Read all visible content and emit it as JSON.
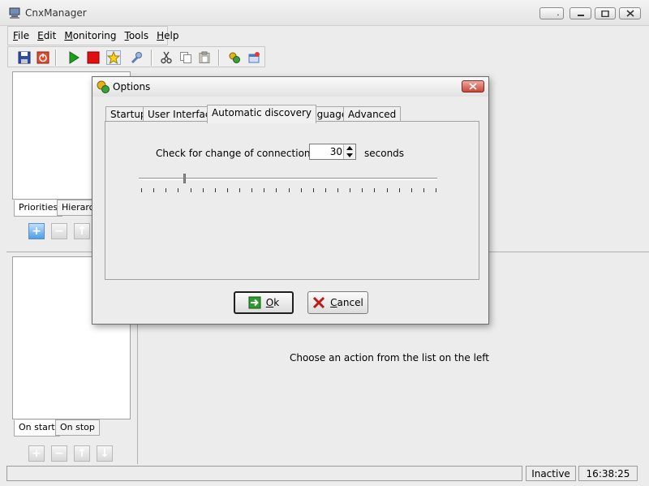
{
  "window": {
    "title": "CnxManager"
  },
  "menu": [
    {
      "label": "File",
      "key": "F",
      "rest": "ile"
    },
    {
      "label": "Edit",
      "key": "E",
      "rest": "dit"
    },
    {
      "label": "Monitoring",
      "key": "M",
      "rest": "onitoring"
    },
    {
      "label": "Tools",
      "key": "T",
      "rest": "ools"
    },
    {
      "label": "Help",
      "key": "H",
      "rest": "elp"
    }
  ],
  "toolbar": {
    "icons": [
      "save-icon",
      "power-icon",
      "play-icon",
      "stop-icon",
      "star-icon",
      "wrench-icon",
      "cut-icon",
      "copy-icon",
      "paste-icon",
      "plugin-icon",
      "window-icon"
    ]
  },
  "left_panel_top": {
    "tabs": [
      "Priorities",
      "Hierarch"
    ]
  },
  "left_panel_bottom": {
    "tabs": [
      "On start",
      "On stop"
    ]
  },
  "right_panel": {
    "message": "Choose an action from the list on the left"
  },
  "status": {
    "state": "Inactive",
    "time": "16:38:25"
  },
  "dialog": {
    "title": "Options",
    "tabs": [
      "Startup",
      "User Interface",
      "Automatic discovery",
      "Language",
      "Advanced"
    ],
    "active_tab": "Automatic discovery",
    "check_label": "Check for change of connection every",
    "interval_value": "30",
    "seconds_label": "seconds",
    "slider_value": 30,
    "ok_label": "Ok",
    "ok_key": "O",
    "ok_rest": "k",
    "cancel_label": "Cancel",
    "cancel_key": "C",
    "cancel_rest": "ancel"
  },
  "colors": {
    "window_bg": "#ececec",
    "accent_blue": "#4d9ee8",
    "stop_red": "#e01010",
    "play_green": "#1aa01a"
  }
}
